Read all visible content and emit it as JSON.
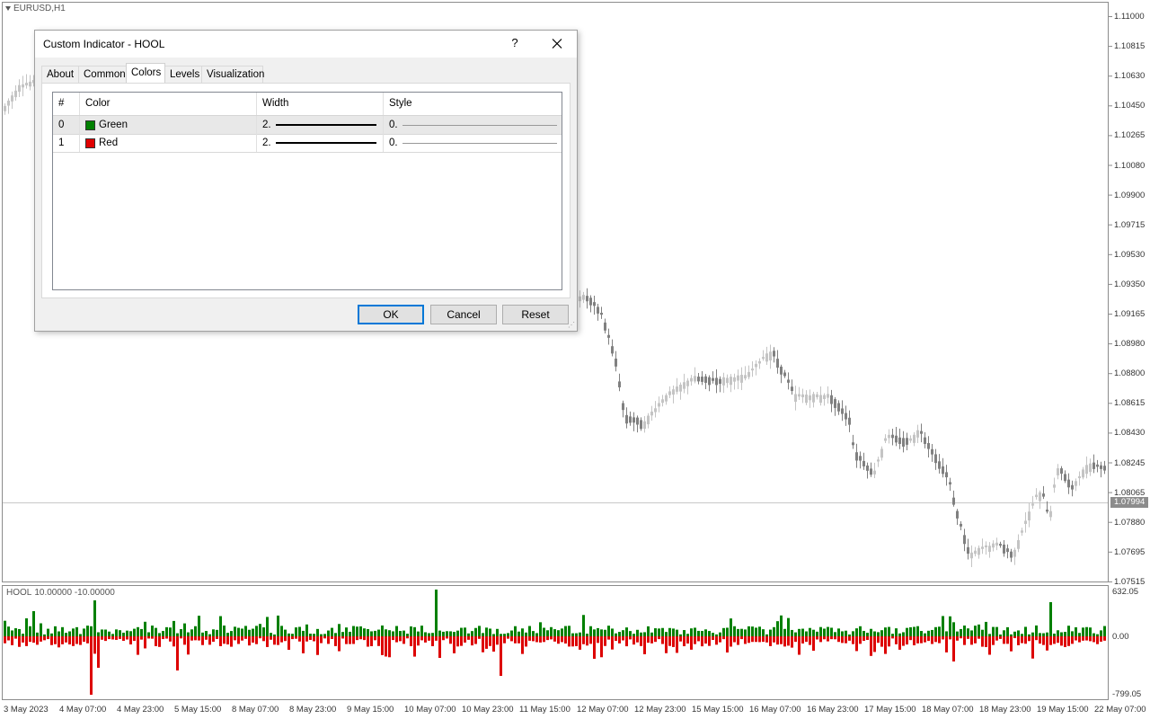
{
  "chart": {
    "symbol": "EURUSD,H1",
    "price_axis": [
      "1.11000",
      "1.10815",
      "1.10630",
      "1.10450",
      "1.10265",
      "1.10080",
      "1.09900",
      "1.09715",
      "1.09530",
      "1.09350",
      "1.09165",
      "1.08980",
      "1.08800",
      "1.08615",
      "1.08430",
      "1.08245",
      "1.08065",
      "1.07880",
      "1.07695",
      "1.07515"
    ],
    "current_price": "1.07994",
    "time_axis": [
      "3 May 2023",
      "4 May 07:00",
      "4 May 23:00",
      "5 May 15:00",
      "8 May 07:00",
      "8 May 23:00",
      "9 May 15:00",
      "10 May 07:00",
      "10 May 23:00",
      "11 May 15:00",
      "12 May 07:00",
      "12 May 23:00",
      "15 May 15:00",
      "16 May 07:00",
      "16 May 23:00",
      "17 May 15:00",
      "18 May 07:00",
      "18 May 23:00",
      "19 May 15:00",
      "22 May 07:00"
    ],
    "colors": {
      "candle": "#808080",
      "candle_light": "#c4c4c4",
      "grid": "#d8d8d8"
    }
  },
  "indicator": {
    "name": "HOOL",
    "levels": "10.00000 -10.00000",
    "axis_max": "632.05",
    "axis_zero": "0.00",
    "axis_min": "-799.05",
    "colors": {
      "up": "#008000",
      "down": "#dd0000"
    }
  },
  "dialog": {
    "title": "Custom Indicator - HOOL",
    "help_label": "?",
    "tabs": [
      "About",
      "Common",
      "Colors",
      "Levels",
      "Visualization"
    ],
    "active_tab": "Colors",
    "columns": [
      "#",
      "Color",
      "Width",
      "Style"
    ],
    "rows": [
      {
        "index": "0",
        "color_name": "Green",
        "swatch": "#008000",
        "width": "2.",
        "style": "0."
      },
      {
        "index": "1",
        "color_name": "Red",
        "swatch": "#e00000",
        "width": "2.",
        "style": "0."
      }
    ],
    "buttons": {
      "ok": "OK",
      "cancel": "Cancel",
      "reset": "Reset"
    }
  }
}
